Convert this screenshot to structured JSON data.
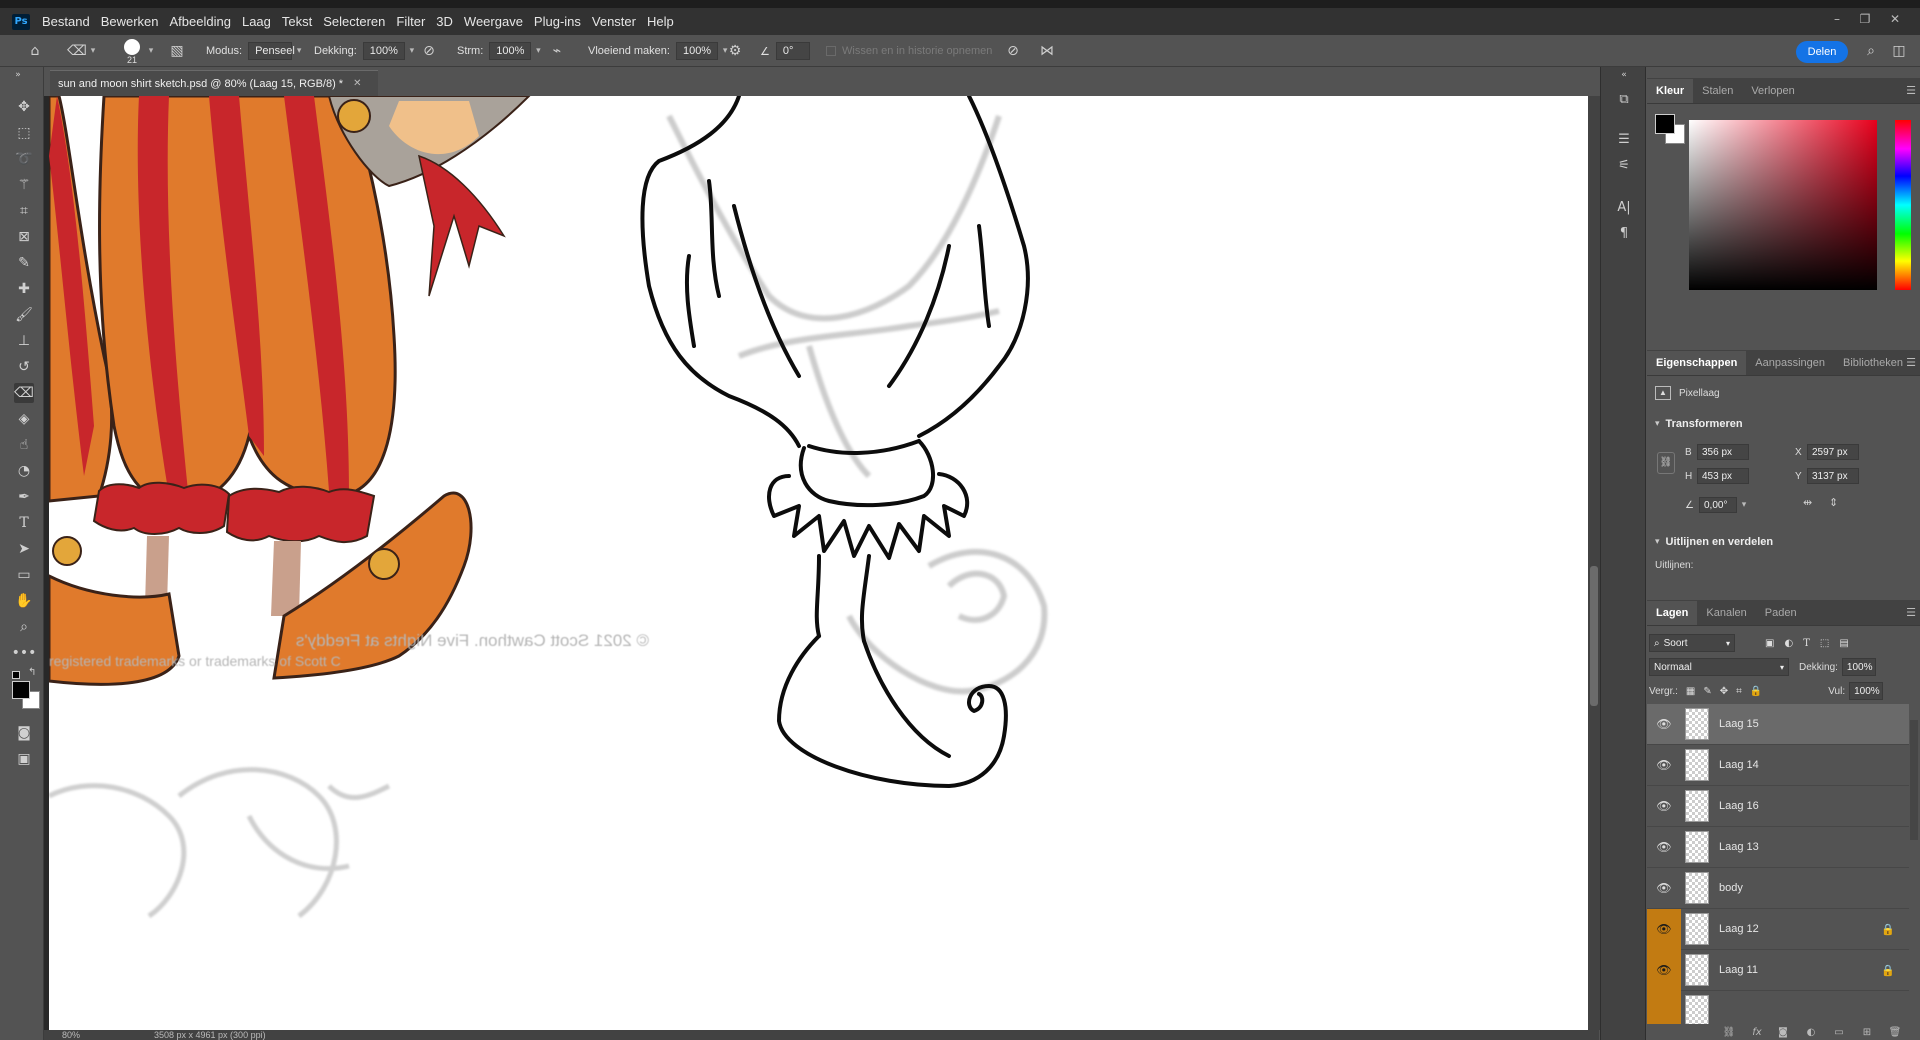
{
  "menubar": {
    "logo": "Ps",
    "items": [
      "Bestand",
      "Bewerken",
      "Afbeelding",
      "Laag",
      "Tekst",
      "Selecteren",
      "Filter",
      "3D",
      "Weergave",
      "Plug-ins",
      "Venster",
      "Help"
    ]
  },
  "options": {
    "brush_size": "21",
    "mode_label": "Modus:",
    "mode_value": "Penseel",
    "opacity_label": "Dekking:",
    "opacity_value": "100%",
    "flow_label": "Strm:",
    "flow_value": "100%",
    "smoothing_label": "Vloeiend maken:",
    "smoothing_value": "100%",
    "angle_value": "0°",
    "history_label": "Wissen en in historie opnemen",
    "share_label": "Delen"
  },
  "document": {
    "tab_title": "sun and moon shirt sketch.psd @ 80% (Laag 15, RGB/8) *",
    "watermark_line1": "© 2021 Scott Cawthon. Five Nights at Freddy's",
    "watermark_line2": "registered trademarks or trademarks of Scott C",
    "zoom": "80%",
    "doc_size": "3508 px x 4961 px (300 ppi)"
  },
  "color_panel": {
    "tabs": [
      "Kleur",
      "Stalen",
      "Verlopen"
    ],
    "active_tab": "Kleur",
    "foreground": "#000000",
    "background": "#ffffff"
  },
  "properties_panel": {
    "tabs": [
      "Eigenschappen",
      "Aanpassingen",
      "Bibliotheken"
    ],
    "layer_type": "Pixellaag",
    "transform_title": "Transformeren",
    "w_label": "B",
    "w_value": "356 px",
    "h_label": "H",
    "h_value": "453 px",
    "x_label": "X",
    "x_value": "2597 px",
    "y_label": "Y",
    "y_value": "3137 px",
    "angle_value": "0,00°",
    "align_title": "Uitlijnen en verdelen",
    "align_label": "Uitlijnen:"
  },
  "layers_panel": {
    "tabs": [
      "Lagen",
      "Kanalen",
      "Paden"
    ],
    "filter_label": "Soort",
    "blend_mode": "Normaal",
    "opacity_label": "Dekking:",
    "opacity_value": "100%",
    "lock_label": "Vergr.:",
    "fill_label": "Vul:",
    "fill_value": "100%",
    "layers": [
      {
        "name": "Laag 15",
        "selected": true,
        "locked": false,
        "orange": false
      },
      {
        "name": "Laag 14",
        "selected": false,
        "locked": false,
        "orange": false
      },
      {
        "name": "Laag 16",
        "selected": false,
        "locked": false,
        "orange": false
      },
      {
        "name": "Laag 13",
        "selected": false,
        "locked": false,
        "orange": false
      },
      {
        "name": "body",
        "selected": false,
        "locked": false,
        "orange": false
      },
      {
        "name": "Laag 12",
        "selected": false,
        "locked": true,
        "orange": true
      },
      {
        "name": "Laag 11",
        "selected": false,
        "locked": true,
        "orange": true
      }
    ]
  },
  "colors": {
    "accent_blue": "#1473e6",
    "layer_orange": "#c27b12",
    "orange_fill": "#e07a2c",
    "red_stripe": "#c8262b"
  }
}
